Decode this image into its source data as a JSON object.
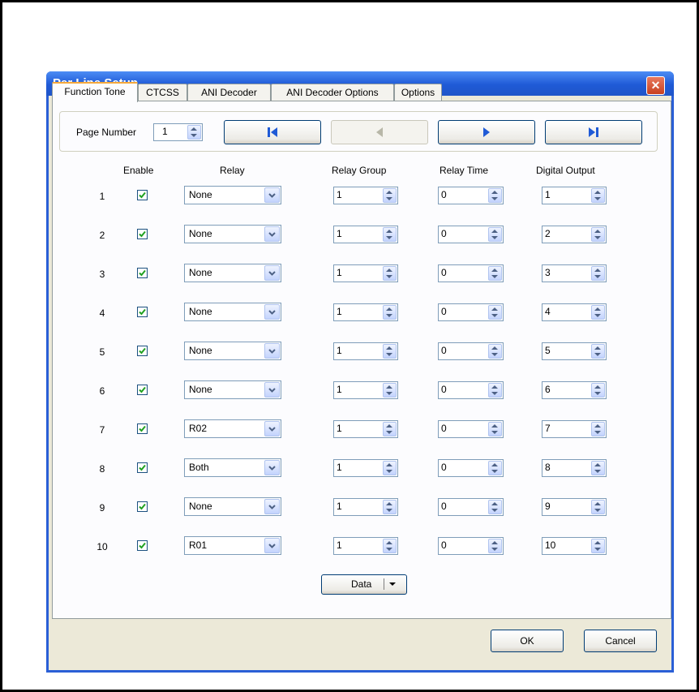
{
  "window": {
    "title": "Per Line Setup",
    "close_glyph": "✕"
  },
  "tabs": [
    "Function Tone",
    "CTCSS",
    "ANI Decoder",
    "ANI Decoder Options",
    "Options"
  ],
  "active_tab": "Function Tone",
  "page": {
    "label": "Page Number",
    "value": "1"
  },
  "nav": {
    "first": "first-page-icon",
    "prev": "previous-page-icon",
    "next": "next-page-icon",
    "last": "last-page-icon"
  },
  "headers": {
    "enable": "Enable",
    "relay": "Relay",
    "relay_group": "Relay Group",
    "relay_time": "Relay Time",
    "digital_output": "Digital Output"
  },
  "rows": [
    {
      "num": "1",
      "enabled": true,
      "relay": "None",
      "relay_group": "1",
      "relay_time": "0",
      "digital_output": "1"
    },
    {
      "num": "2",
      "enabled": true,
      "relay": "None",
      "relay_group": "1",
      "relay_time": "0",
      "digital_output": "2"
    },
    {
      "num": "3",
      "enabled": true,
      "relay": "None",
      "relay_group": "1",
      "relay_time": "0",
      "digital_output": "3"
    },
    {
      "num": "4",
      "enabled": true,
      "relay": "None",
      "relay_group": "1",
      "relay_time": "0",
      "digital_output": "4"
    },
    {
      "num": "5",
      "enabled": true,
      "relay": "None",
      "relay_group": "1",
      "relay_time": "0",
      "digital_output": "5"
    },
    {
      "num": "6",
      "enabled": true,
      "relay": "None",
      "relay_group": "1",
      "relay_time": "0",
      "digital_output": "6"
    },
    {
      "num": "7",
      "enabled": true,
      "relay": "R02",
      "relay_group": "1",
      "relay_time": "0",
      "digital_output": "7"
    },
    {
      "num": "8",
      "enabled": true,
      "relay": "Both",
      "relay_group": "1",
      "relay_time": "0",
      "digital_output": "8"
    },
    {
      "num": "9",
      "enabled": true,
      "relay": "None",
      "relay_group": "1",
      "relay_time": "0",
      "digital_output": "9"
    },
    {
      "num": "10",
      "enabled": true,
      "relay": "R01",
      "relay_group": "1",
      "relay_time": "0",
      "digital_output": "10"
    }
  ],
  "data_button": "Data",
  "buttons": {
    "ok": "OK",
    "cancel": "Cancel"
  },
  "colors": {
    "titlebar": "#1f5ad6",
    "check": "#21a121",
    "dialog_bg": "#ece9d8"
  }
}
